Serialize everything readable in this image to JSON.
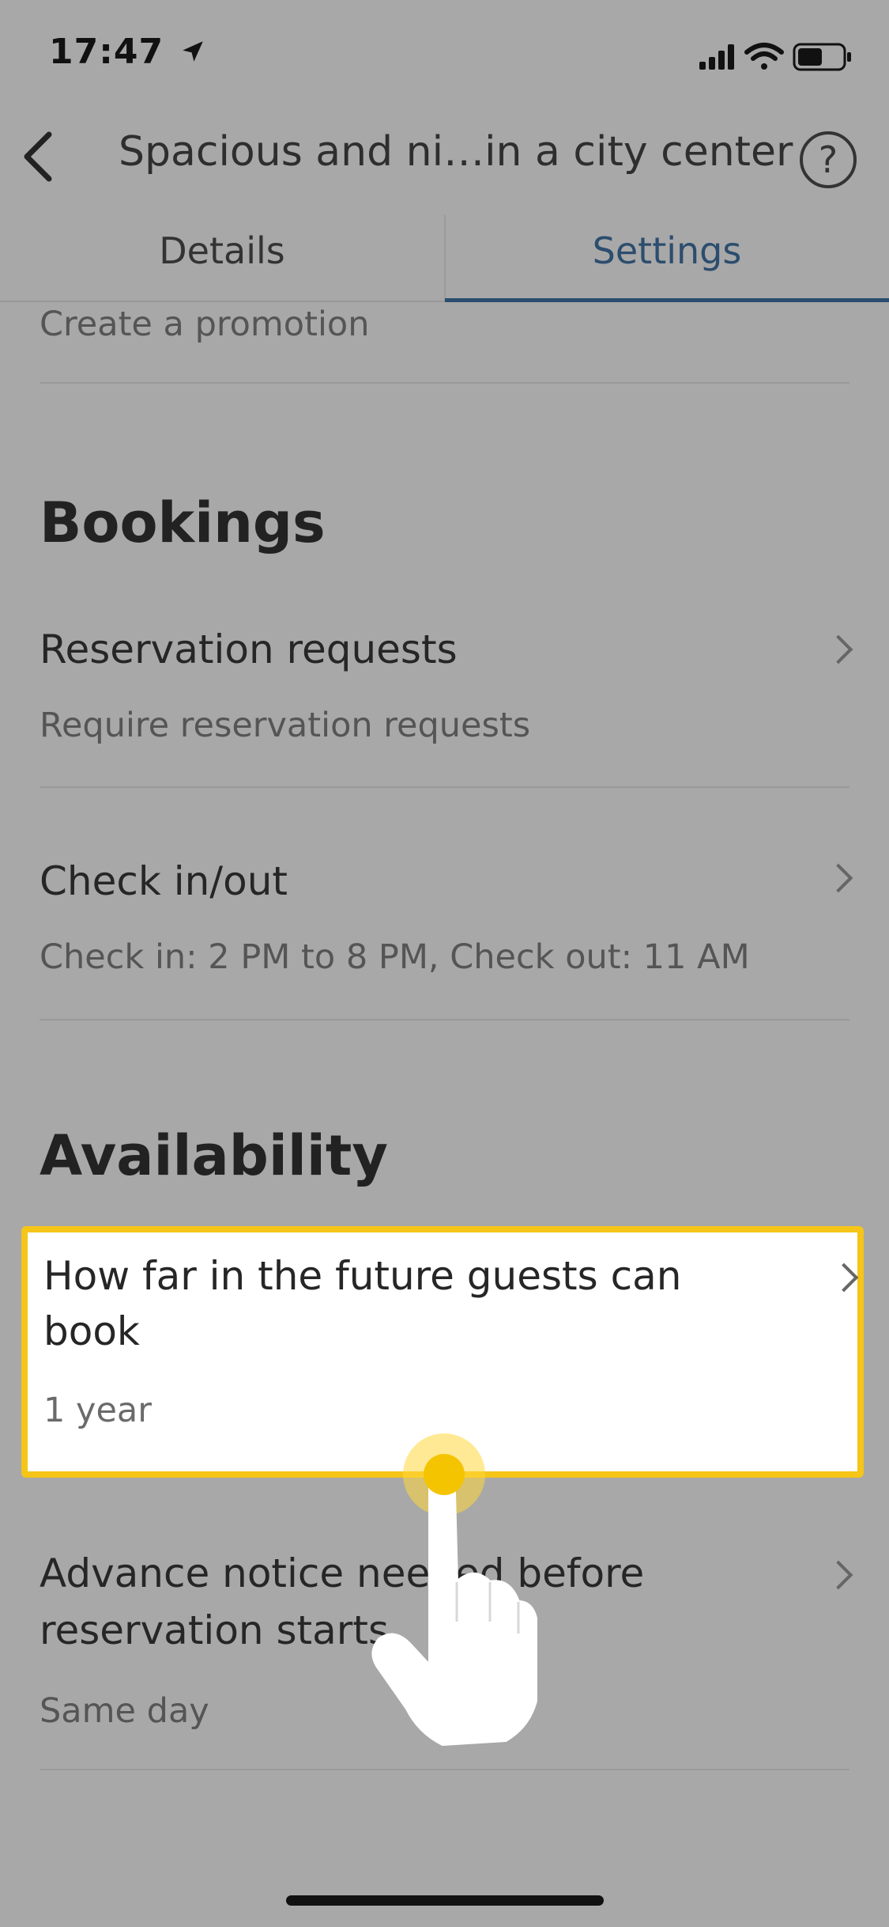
{
  "status": {
    "time": "17:47"
  },
  "header": {
    "title": "Spacious and ni…in a city center",
    "help_symbol": "?"
  },
  "tabs": [
    {
      "label": "Details",
      "active": false
    },
    {
      "label": "Settings",
      "active": true
    }
  ],
  "promotion": {
    "label": "Create a promotion"
  },
  "bookings": {
    "heading": "Bookings",
    "items": [
      {
        "title": "Reservation requests",
        "subtitle": "Require reservation requests"
      },
      {
        "title": "Check in/out",
        "subtitle": "Check in: 2 PM to 8 PM, Check out: 11 AM"
      }
    ]
  },
  "availability": {
    "heading": "Availability",
    "items": [
      {
        "title_line1": "How far in the future guests can",
        "title_line2": "book",
        "subtitle": "1 year",
        "highlighted": true
      },
      {
        "title_line1": "Advance notice needed before",
        "title_line2": "reservation starts",
        "subtitle": "Same day"
      }
    ]
  },
  "colors": {
    "accent": "#2c4d6e",
    "highlight": "#f5c518",
    "overlay": "#a8a8a8"
  },
  "icons": [
    "location-arrow-icon",
    "signal-icon",
    "wifi-icon",
    "battery-icon",
    "back-chevron-icon",
    "help-icon",
    "chevron-right-icon",
    "tap-hand-icon"
  ]
}
